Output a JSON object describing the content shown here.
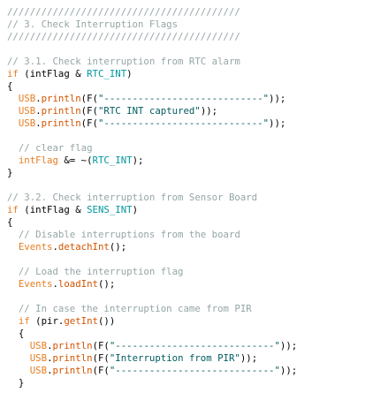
{
  "colors": {
    "comment": "#95a5a6",
    "keyword": "#e67e22",
    "function": "#d35400",
    "constant": "#00979d",
    "string": "#005c5f",
    "plain": "#000000"
  },
  "lines": [
    [
      [
        "comment",
        "/////////////////////////////////////////"
      ]
    ],
    [
      [
        "comment",
        "// 3. Check Interruption Flags"
      ]
    ],
    [
      [
        "comment",
        "/////////////////////////////////////////"
      ]
    ],
    [],
    [
      [
        "comment",
        "// 3.1. Check interruption from RTC alarm"
      ]
    ],
    [
      [
        "keyword",
        "if"
      ],
      [
        "plain",
        " (intFlag & "
      ],
      [
        "constant",
        "RTC_INT"
      ],
      [
        "plain",
        ")"
      ]
    ],
    [
      [
        "plain",
        "{"
      ]
    ],
    [
      [
        "plain",
        "  "
      ],
      [
        "keyword",
        "USB"
      ],
      [
        "plain",
        "."
      ],
      [
        "function",
        "println"
      ],
      [
        "plain",
        "(F("
      ],
      [
        "string",
        "\"----------------------------\""
      ],
      [
        "plain",
        "));"
      ]
    ],
    [
      [
        "plain",
        "  "
      ],
      [
        "keyword",
        "USB"
      ],
      [
        "plain",
        "."
      ],
      [
        "function",
        "println"
      ],
      [
        "plain",
        "(F("
      ],
      [
        "string",
        "\"RTC INT captured\""
      ],
      [
        "plain",
        "));"
      ]
    ],
    [
      [
        "plain",
        "  "
      ],
      [
        "keyword",
        "USB"
      ],
      [
        "plain",
        "."
      ],
      [
        "function",
        "println"
      ],
      [
        "plain",
        "(F("
      ],
      [
        "string",
        "\"----------------------------\""
      ],
      [
        "plain",
        "));"
      ]
    ],
    [],
    [
      [
        "plain",
        "  "
      ],
      [
        "comment",
        "// clear flag"
      ]
    ],
    [
      [
        "plain",
        "  "
      ],
      [
        "keyword",
        "intFlag"
      ],
      [
        "plain",
        " &= ~("
      ],
      [
        "constant",
        "RTC_INT"
      ],
      [
        "plain",
        ");"
      ]
    ],
    [
      [
        "plain",
        "}"
      ]
    ],
    [],
    [
      [
        "comment",
        "// 3.2. Check interruption from Sensor Board"
      ]
    ],
    [
      [
        "keyword",
        "if"
      ],
      [
        "plain",
        " (intFlag & "
      ],
      [
        "constant",
        "SENS_INT"
      ],
      [
        "plain",
        ")"
      ]
    ],
    [
      [
        "plain",
        "{"
      ]
    ],
    [
      [
        "plain",
        "  "
      ],
      [
        "comment",
        "// Disable interruptions from the board"
      ]
    ],
    [
      [
        "plain",
        "  "
      ],
      [
        "keyword",
        "Events"
      ],
      [
        "plain",
        "."
      ],
      [
        "function",
        "detachInt"
      ],
      [
        "plain",
        "();"
      ]
    ],
    [],
    [
      [
        "plain",
        "  "
      ],
      [
        "comment",
        "// Load the interruption flag"
      ]
    ],
    [
      [
        "plain",
        "  "
      ],
      [
        "keyword",
        "Events"
      ],
      [
        "plain",
        "."
      ],
      [
        "function",
        "loadInt"
      ],
      [
        "plain",
        "();"
      ]
    ],
    [],
    [
      [
        "plain",
        "  "
      ],
      [
        "comment",
        "// In case the interruption came from PIR"
      ]
    ],
    [
      [
        "plain",
        "  "
      ],
      [
        "keyword",
        "if"
      ],
      [
        "plain",
        " (pir."
      ],
      [
        "function",
        "getInt"
      ],
      [
        "plain",
        "())"
      ]
    ],
    [
      [
        "plain",
        "  {"
      ]
    ],
    [
      [
        "plain",
        "    "
      ],
      [
        "keyword",
        "USB"
      ],
      [
        "plain",
        "."
      ],
      [
        "function",
        "println"
      ],
      [
        "plain",
        "(F("
      ],
      [
        "string",
        "\"----------------------------\""
      ],
      [
        "plain",
        "));"
      ]
    ],
    [
      [
        "plain",
        "    "
      ],
      [
        "keyword",
        "USB"
      ],
      [
        "plain",
        "."
      ],
      [
        "function",
        "println"
      ],
      [
        "plain",
        "(F("
      ],
      [
        "string",
        "\"Interruption from PIR\""
      ],
      [
        "plain",
        "));"
      ]
    ],
    [
      [
        "plain",
        "    "
      ],
      [
        "keyword",
        "USB"
      ],
      [
        "plain",
        "."
      ],
      [
        "function",
        "println"
      ],
      [
        "plain",
        "(F("
      ],
      [
        "string",
        "\"----------------------------\""
      ],
      [
        "plain",
        "));"
      ]
    ],
    [
      [
        "plain",
        "  }"
      ]
    ]
  ]
}
